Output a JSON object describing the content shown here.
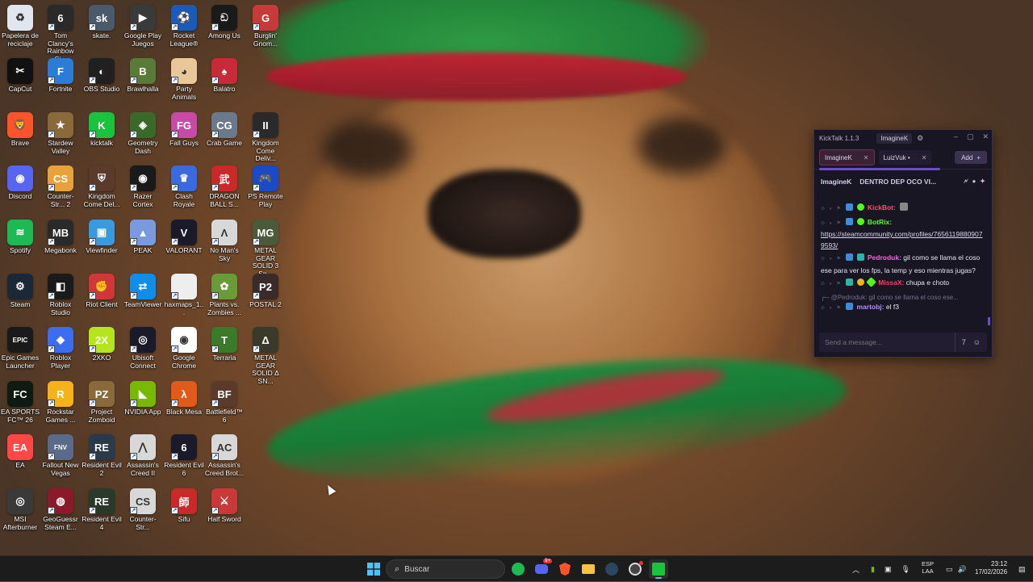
{
  "desktop": {
    "columns": [
      [
        {
          "label": "Papelera de reciclaje",
          "icon": "recycle-bin-icon",
          "color": "#dfe6ee",
          "glyph": "♻"
        },
        {
          "label": "CapCut",
          "icon": "capcut-icon",
          "color": "#111111",
          "glyph": "✂"
        },
        {
          "label": "Brave",
          "icon": "brave-icon",
          "color": "#fb542b",
          "glyph": "🦁"
        },
        {
          "label": "Discord",
          "icon": "discord-icon",
          "color": "#5865f2",
          "glyph": "◉"
        },
        {
          "label": "Spotify",
          "icon": "spotify-icon",
          "color": "#1db954",
          "glyph": "≋"
        },
        {
          "label": "Steam",
          "icon": "steam-icon",
          "color": "#1b2838",
          "glyph": "⚙"
        },
        {
          "label": "Epic Games Launcher",
          "icon": "epic-games-icon",
          "color": "#1a1a1a",
          "glyph": "EPIC"
        },
        {
          "label": "EA SPORTS FC™ 26",
          "icon": "ea-sports-fc-icon",
          "color": "#0f1a12",
          "glyph": "FC"
        },
        {
          "label": "EA",
          "icon": "ea-icon",
          "color": "#ff4747",
          "glyph": "EA"
        },
        {
          "label": "MSI Afterburner",
          "icon": "msi-afterburner-icon",
          "color": "#3a3a3a",
          "glyph": "◎"
        }
      ],
      [
        {
          "label": "Tom Clancy's Rainbow Si...",
          "icon": "rainbow-six-icon",
          "color": "#2a2a2a",
          "glyph": "6"
        },
        {
          "label": "Fortnite",
          "icon": "fortnite-icon",
          "color": "#2a7cd6",
          "glyph": "F"
        },
        {
          "label": "Stardew Valley",
          "icon": "stardew-valley-icon",
          "color": "#8a6a3a",
          "glyph": "★"
        },
        {
          "label": "Counter-Str... 2",
          "icon": "counter-strike-2-icon",
          "color": "#e8a23a",
          "glyph": "CS"
        },
        {
          "label": "Megabonk",
          "icon": "megabonk-icon",
          "color": "#2a2a2a",
          "glyph": "MB"
        },
        {
          "label": "Roblox Studio",
          "icon": "roblox-studio-icon",
          "color": "#1a1a1a",
          "glyph": "◧"
        },
        {
          "label": "Roblox Player",
          "icon": "roblox-player-icon",
          "color": "#3a6df0",
          "glyph": "◆"
        },
        {
          "label": "Rockstar Games ...",
          "icon": "rockstar-games-icon",
          "color": "#f5b21b",
          "glyph": "R"
        },
        {
          "label": "Fallout New Vegas",
          "icon": "fallout-new-vegas-icon",
          "color": "#5a6a8a",
          "glyph": "FNV"
        },
        {
          "label": "GeoGuessr Steam E...",
          "icon": "geoguessr-icon",
          "color": "#8a1a2a",
          "glyph": "◍"
        }
      ],
      [
        {
          "label": "skate.",
          "icon": "skate-icon",
          "color": "#4a5a6a",
          "glyph": "sk"
        },
        {
          "label": "OBS Studio",
          "icon": "obs-studio-icon",
          "color": "#202020",
          "glyph": "◐"
        },
        {
          "label": "kicktalk",
          "icon": "kicktalk-icon",
          "color": "#1ac33c",
          "glyph": "K"
        },
        {
          "label": "Kingdom Come Del...",
          "icon": "kingdom-come-icon",
          "color": "#5a3a2a",
          "glyph": "⛨"
        },
        {
          "label": "Viewfinder",
          "icon": "viewfinder-icon",
          "color": "#3a9ae0",
          "glyph": "▣"
        },
        {
          "label": "Riot Client",
          "icon": "riot-client-icon",
          "color": "#d13639",
          "glyph": "✊"
        },
        {
          "label": "2XKO",
          "icon": "2xko-icon",
          "color": "#b5e61d",
          "glyph": "2X"
        },
        {
          "label": "Project Zomboid",
          "icon": "project-zomboid-icon",
          "color": "#8a6a3a",
          "glyph": "PZ"
        },
        {
          "label": "Resident Evil 2",
          "icon": "resident-evil-2-icon",
          "color": "#2a3a4a",
          "glyph": "RE"
        },
        {
          "label": "Resident Evil 4",
          "icon": "resident-evil-4-icon",
          "color": "#2a3a2a",
          "glyph": "RE"
        }
      ],
      [
        {
          "label": "Google Play Juegos",
          "icon": "google-play-games-icon",
          "color": "#3a3a3a",
          "glyph": "▶"
        },
        {
          "label": "Brawlhalla",
          "icon": "brawlhalla-icon",
          "color": "#5a7a3a",
          "glyph": "B"
        },
        {
          "label": "Geometry Dash",
          "icon": "geometry-dash-icon",
          "color": "#3a6a2a",
          "glyph": "◈"
        },
        {
          "label": "Razer Cortex",
          "icon": "razer-cortex-icon",
          "color": "#1a1a1a",
          "glyph": "◉"
        },
        {
          "label": "PEAK",
          "icon": "peak-icon",
          "color": "#7a9ae0",
          "glyph": "▲"
        },
        {
          "label": "TeamViewer",
          "icon": "teamviewer-icon",
          "color": "#0e8ee9",
          "glyph": "⇄"
        },
        {
          "label": "Ubisoft Connect",
          "icon": "ubisoft-connect-icon",
          "color": "#1a1a2a",
          "glyph": "◎"
        },
        {
          "label": "NVIDIA App",
          "icon": "nvidia-app-icon",
          "color": "#76b900",
          "glyph": "◣"
        },
        {
          "label": "Assassin's Creed II",
          "icon": "assassins-creed-ii-icon",
          "color": "#d8d8d8",
          "glyph": "⋀"
        },
        {
          "label": "Counter-Str...",
          "icon": "counter-strike-icon",
          "color": "#d8d8d8",
          "glyph": "CS"
        }
      ],
      [
        {
          "label": "Rocket League®",
          "icon": "rocket-league-icon",
          "color": "#1a5ab8",
          "glyph": "⚽"
        },
        {
          "label": "Party Animals",
          "icon": "party-animals-icon",
          "color": "#e8c89a",
          "glyph": "◕"
        },
        {
          "label": "Fall Guys",
          "icon": "fall-guys-icon",
          "color": "#c84aa8",
          "glyph": "FG"
        },
        {
          "label": "Clash Royale",
          "icon": "clash-royale-icon",
          "color": "#3a6ae0",
          "glyph": "♛"
        },
        {
          "label": "VALORANT",
          "icon": "valorant-icon",
          "color": "#1a1a2a",
          "glyph": "V"
        },
        {
          "label": "haxmaps_1...",
          "icon": "file-icon",
          "color": "#eeeeee",
          "glyph": ""
        },
        {
          "label": "Google Chrome",
          "icon": "google-chrome-icon",
          "color": "#ffffff",
          "glyph": "◉"
        },
        {
          "label": "Black Mesa",
          "icon": "black-mesa-icon",
          "color": "#e05a1a",
          "glyph": "λ"
        },
        {
          "label": "Resident Evil 6",
          "icon": "resident-evil-6-icon",
          "color": "#1a1a2a",
          "glyph": "6"
        },
        {
          "label": "Sifu",
          "icon": "sifu-icon",
          "color": "#c82a2a",
          "glyph": "師"
        }
      ],
      [
        {
          "label": "Among Us",
          "icon": "among-us-icon",
          "color": "#1a1a1a",
          "glyph": "ඞ"
        },
        {
          "label": "Balatro",
          "icon": "balatro-icon",
          "color": "#c82a3a",
          "glyph": "♠"
        },
        {
          "label": "Crab Game",
          "icon": "crab-game-icon",
          "color": "#6a7a8a",
          "glyph": "CG"
        },
        {
          "label": "DRAGON BALL S...",
          "icon": "dragon-ball-icon",
          "color": "#c82a2a",
          "glyph": "武"
        },
        {
          "label": "No Man's Sky",
          "icon": "no-mans-sky-icon",
          "color": "#d8d8d8",
          "glyph": "Λ"
        },
        {
          "label": "Plants vs. Zombies ...",
          "icon": "plants-vs-zombies-icon",
          "color": "#6a9a3a",
          "glyph": "✿"
        },
        {
          "label": "Terraria",
          "icon": "terraria-icon",
          "color": "#3a7a2a",
          "glyph": "T"
        },
        {
          "label": "Battlefield™ 6",
          "icon": "battlefield-6-icon",
          "color": "#5a3a2a",
          "glyph": "BF"
        },
        {
          "label": "Assassin's Creed Brot...",
          "icon": "assassins-creed-brotherhood-icon",
          "color": "#d8d8d8",
          "glyph": "AC"
        },
        {
          "label": "Half Sword",
          "icon": "half-sword-icon",
          "color": "#c83a3a",
          "glyph": "⚔"
        }
      ],
      [
        {
          "label": "Burglin' Gnom...",
          "icon": "burglin-gnomes-icon",
          "color": "#c83a3a",
          "glyph": "G"
        },
        {
          "label": "",
          "icon": "",
          "color": "",
          "glyph": ""
        },
        {
          "label": "Kingdom Come Deliv...",
          "icon": "kingdom-come-deliverance-ii-icon",
          "color": "#2a2a2a",
          "glyph": "II"
        },
        {
          "label": "PS Remote Play",
          "icon": "ps-remote-play-icon",
          "color": "#1a4ac8",
          "glyph": "🎮"
        },
        {
          "label": "METAL GEAR SOLID 3 Sn...",
          "icon": "metal-gear-solid-3-icon",
          "color": "#4a5a3a",
          "glyph": "MG"
        },
        {
          "label": "POSTAL 2",
          "icon": "postal-2-icon",
          "color": "#3a2a2a",
          "glyph": "P2"
        },
        {
          "label": "METAL GEAR SOLID Δ SN...",
          "icon": "metal-gear-solid-delta-icon",
          "color": "#3a3a2a",
          "glyph": "Δ"
        },
        {
          "label": "",
          "icon": "",
          "color": "",
          "glyph": ""
        },
        {
          "label": "",
          "icon": "",
          "color": "",
          "glyph": ""
        },
        {
          "label": "",
          "icon": "",
          "color": "",
          "glyph": ""
        }
      ]
    ]
  },
  "kicktalk": {
    "app_title": "KickTalk 1.1.3",
    "user": "ImagineK",
    "tabs": [
      {
        "label": "ImagineK",
        "active": true
      },
      {
        "label": "LuizVuk •",
        "active": false
      }
    ],
    "add_label": "Add",
    "stream_channel": "ImagineK",
    "stream_title": "DENTRO DEP OCO VI...",
    "messages": [
      {
        "user": "KickBot:",
        "text": "",
        "user_class": "u-kickbot"
      },
      {
        "user": "BotRix:",
        "text": "https://steamcommunity.com/profiles/76561198809079593/",
        "user_class": "u-botrix",
        "is_link": true
      },
      {
        "user": "Pedroduk:",
        "text": "gil como se llama el coso ese para ver los fps, la temp y eso mientras jugas?",
        "user_class": "u-pedro"
      },
      {
        "user": "MissaX:",
        "text": "chupa e choto",
        "user_class": "u-missa"
      },
      {
        "reply": "@Pedroduk: gil como se llama el coso ese..."
      },
      {
        "user": "martobj:",
        "text": "el f3",
        "user_class": "u-martob"
      }
    ],
    "input_placeholder": "Send a message..."
  },
  "taskbar": {
    "search_placeholder": "Buscar",
    "lang_line1": "ESP",
    "lang_line2": "LAA",
    "time": "23:12",
    "date": "17/02/2026",
    "discord_badge": "9+"
  }
}
